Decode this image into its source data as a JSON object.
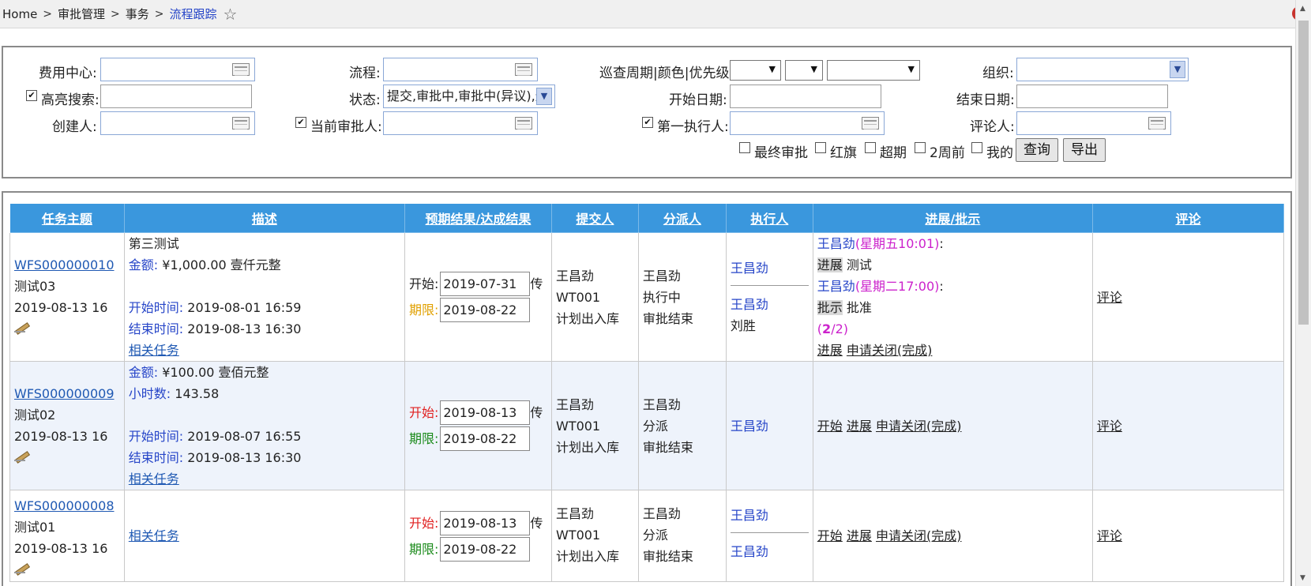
{
  "breadcrumb": {
    "items": [
      "Home",
      "审批管理",
      "事务"
    ],
    "current": "流程跟踪",
    "separator": ">"
  },
  "filters": {
    "cost_center_label": "费用中心:",
    "highlight_search_label": "高亮搜索:",
    "highlight_search_checked": true,
    "creator_label": "创建人:",
    "process_label": "流程:",
    "status_label": "状态:",
    "status_value": "提交,审批中,审批中(异议),退",
    "current_approver_label": "当前审批人:",
    "current_approver_checked": true,
    "patrol_label": "巡查周期|颜色|优先级:",
    "start_date_label": "开始日期:",
    "first_executor_label": "第一执行人:",
    "first_executor_checked": true,
    "org_label": "组织:",
    "end_date_label": "结束日期:",
    "commenter_label": "评论人:",
    "checks": [
      {
        "label": "最终审批",
        "checked": false
      },
      {
        "label": "红旗",
        "checked": false
      },
      {
        "label": "超期",
        "checked": false
      },
      {
        "label": "2周前",
        "checked": false
      },
      {
        "label": "我的",
        "checked": false
      }
    ],
    "query_button": "查询",
    "export_button": "导出"
  },
  "table": {
    "headers": [
      "任务主题",
      "描述",
      "预期结果/达成结果",
      "提交人",
      "分派人",
      "执行人",
      "进展/批示",
      "评论"
    ],
    "rows": [
      {
        "id": "WFS000000010",
        "name": "测试03",
        "date": "2019-08-13 16",
        "desc_title": "第三测试",
        "amount_label": "金额:",
        "amount": " ¥1,000.00 壹仟元整",
        "start_label": "开始时间:",
        "start": " 2019-08-01 16:59",
        "end_label": "结束时间:",
        "end": " 2019-08-13 16:30",
        "related": "相关任务",
        "plan_start_label": "开始:",
        "plan_start": "2019-07-31",
        "plan_due_label": "期限:",
        "plan_due": "2019-08-22",
        "trail": "传",
        "submitter": "王昌劲",
        "submitter_code": "WT001",
        "submitter_dept": "计划出入库",
        "assigner": "王昌劲",
        "assigner_s1": "执行中",
        "assigner_s2": "审批结束",
        "executor1": "王昌劲",
        "executor2": "王昌劲",
        "executor3": "刘胜",
        "p1_name": "王昌劲",
        "p1_time": "(星期五10:01)",
        "p1_tag": "进展",
        "p1_text": " 测试",
        "p2_name": "王昌劲",
        "p2_time": "(星期二17:00)",
        "p2_tag": "批示",
        "p2_text": " 批准",
        "p_count_open": "(",
        "p_count_a": "2",
        "p_count_b": "/2)",
        "a1": "进展",
        "a2": "申请关闭(完成)",
        "comment": "评论"
      },
      {
        "id": "WFS000000009",
        "name": "测试02",
        "date": "2019-08-13 16",
        "amount_label": "金额:",
        "amount": " ¥100.00 壹佰元整",
        "hours_label": "小时数:",
        "hours": " 143.58",
        "start_label": "开始时间:",
        "start": " 2019-08-07 16:55",
        "end_label": "结束时间:",
        "end": " 2019-08-13 16:30",
        "related": "相关任务",
        "plan_start_label": "开始:",
        "plan_start": "2019-08-13",
        "plan_due_label": "期限:",
        "plan_due": "2019-08-22",
        "trail": "传",
        "submitter": "王昌劲",
        "submitter_code": "WT001",
        "submitter_dept": "计划出入库",
        "assigner": "王昌劲",
        "assigner_s1": "分派",
        "assigner_s2": "审批结束",
        "executor1": "王昌劲",
        "a0": "开始",
        "a1": "进展",
        "a2": "申请关闭(完成)",
        "comment": "评论"
      },
      {
        "id": "WFS000000008",
        "name": "测试01",
        "date": "2019-08-13 16",
        "related": "相关任务",
        "plan_start_label": "开始:",
        "plan_start": "2019-08-13",
        "plan_due_label": "期限:",
        "plan_due": "2019-08-22",
        "trail": "传",
        "submitter": "王昌劲",
        "submitter_code": "WT001",
        "submitter_dept": "计划出入库",
        "assigner": "王昌劲",
        "assigner_s1": "分派",
        "assigner_s2": "审批结束",
        "executor1": "王昌劲",
        "executor2": "王昌劲",
        "a0": "开始",
        "a1": "进展",
        "a2": "申请关闭(完成)",
        "comment": "评论"
      }
    ]
  },
  "colors": {
    "header_bg": "#3a97dd",
    "link": "#1f59b3",
    "accent_blue": "#2645c8",
    "magenta": "#cc22cc"
  }
}
